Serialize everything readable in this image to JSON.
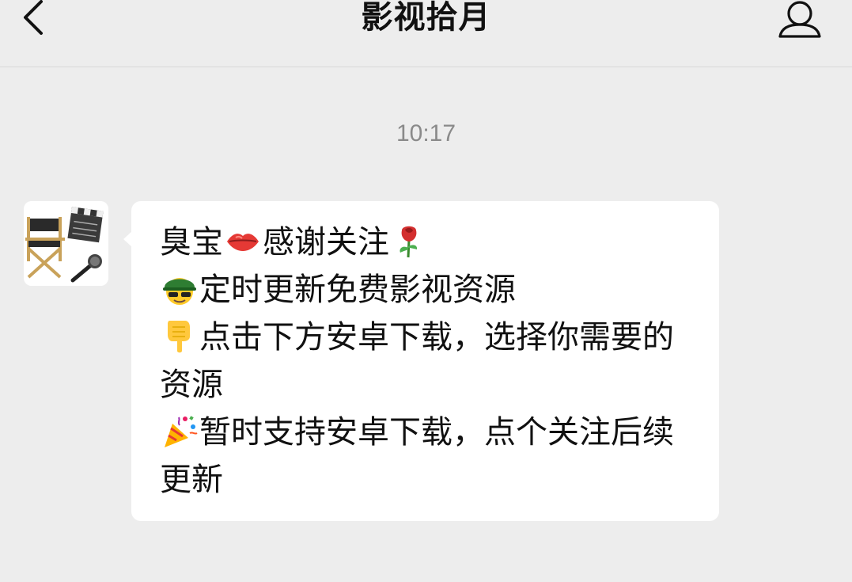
{
  "header": {
    "title": "影视拾月",
    "back_icon": "chevron-left-icon",
    "profile_icon": "user-icon"
  },
  "chat": {
    "timestamp": "10:17",
    "message": {
      "line1_a": "臭宝",
      "line1_b": "感谢关注",
      "line2": "定时更新免费影视资源",
      "line3": "点击下方安卓下载，选择你需要的资源",
      "line4": "暂时支持安卓下载，点个关注后续更新"
    },
    "avatar_icon": "director-chair-clapperboard-avatar",
    "emojis": [
      "lips-icon",
      "rose-icon",
      "helmet-face-icon",
      "pointing-down-icon",
      "party-popper-icon"
    ]
  },
  "colors": {
    "background": "#ededed",
    "bubble": "#ffffff",
    "timestamp": "#8a8a8a"
  }
}
